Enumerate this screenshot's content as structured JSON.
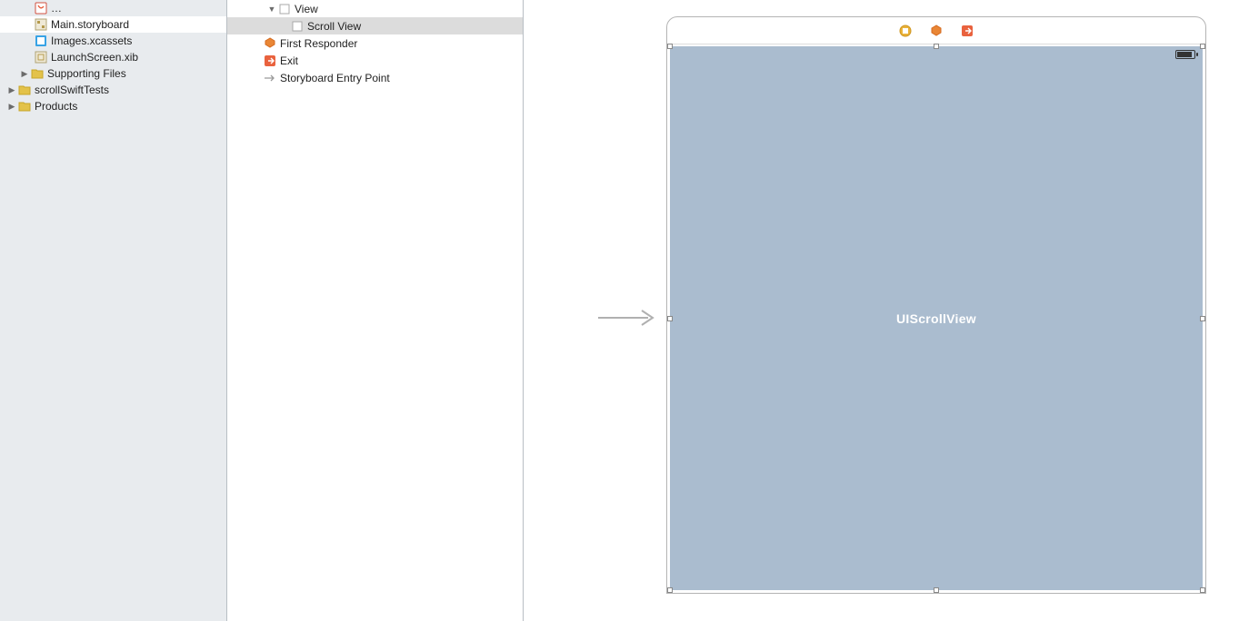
{
  "nav": {
    "items": [
      {
        "indent": "ind1",
        "selected": true,
        "icon": "storyboard",
        "label": "Main.storyboard"
      },
      {
        "indent": "ind1",
        "selected": false,
        "icon": "xcassets",
        "label": "Images.xcassets"
      },
      {
        "indent": "ind1",
        "selected": false,
        "icon": "xib",
        "label": "LaunchScreen.xib"
      },
      {
        "indent": "ind0d",
        "selected": false,
        "icon": "folder",
        "disclosure": "right",
        "label": "Supporting Files"
      },
      {
        "indent": "ind0",
        "selected": false,
        "icon": "folder",
        "disclosure": "right",
        "label": "scrollSwiftTests"
      },
      {
        "indent": "ind0",
        "selected": false,
        "icon": "folder",
        "disclosure": "right",
        "label": "Products"
      }
    ]
  },
  "outline": {
    "items": [
      {
        "depth": 0,
        "disclosure": "down",
        "selected": false,
        "icon": "rect",
        "label": "View"
      },
      {
        "depth": 1,
        "disclosure": "",
        "selected": true,
        "icon": "rect",
        "label": "Scroll View"
      },
      {
        "depth": -1,
        "disclosure": "",
        "selected": false,
        "icon": "responder",
        "label": "First Responder"
      },
      {
        "depth": -1,
        "disclosure": "",
        "selected": false,
        "icon": "exit",
        "label": "Exit"
      },
      {
        "depth": -1,
        "disclosure": "",
        "selected": false,
        "icon": "entry-arrow",
        "label": "Storyboard Entry Point"
      }
    ]
  },
  "canvas": {
    "head_icons": [
      "shield",
      "cube",
      "exit"
    ],
    "scroll_label": "UIScrollView"
  }
}
